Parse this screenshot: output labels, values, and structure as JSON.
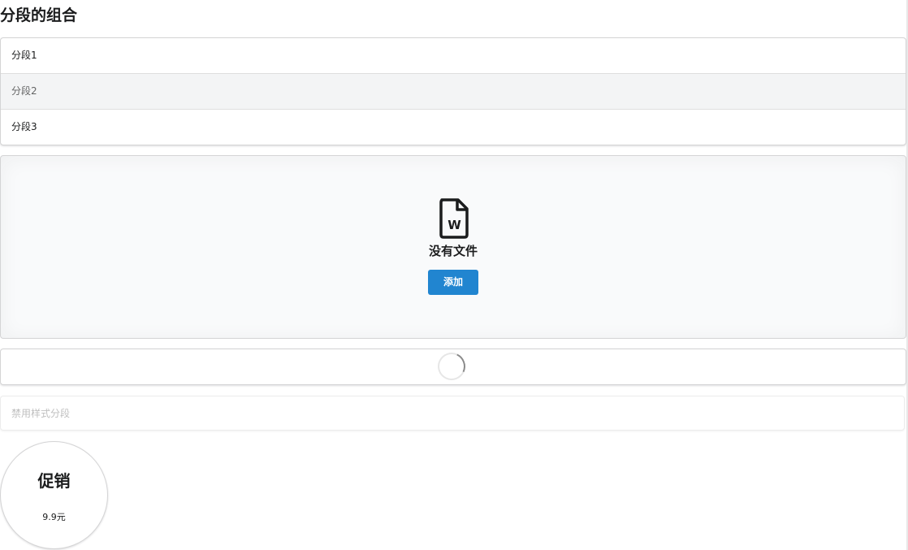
{
  "page": {
    "title": "分段的组合"
  },
  "segments": [
    {
      "label": "分段1"
    },
    {
      "label": "分段2"
    },
    {
      "label": "分段3"
    }
  ],
  "placeholder": {
    "icon": "word-file-icon",
    "header": "没有文件",
    "button_label": "添加",
    "button_color": "#2185d0"
  },
  "loading_segment": {
    "icon": "loading-spinner-icon"
  },
  "disabled_segment": {
    "label": "禁用样式分段"
  },
  "circle_segment": {
    "title": "促销",
    "subtitle": "9.9元"
  }
}
